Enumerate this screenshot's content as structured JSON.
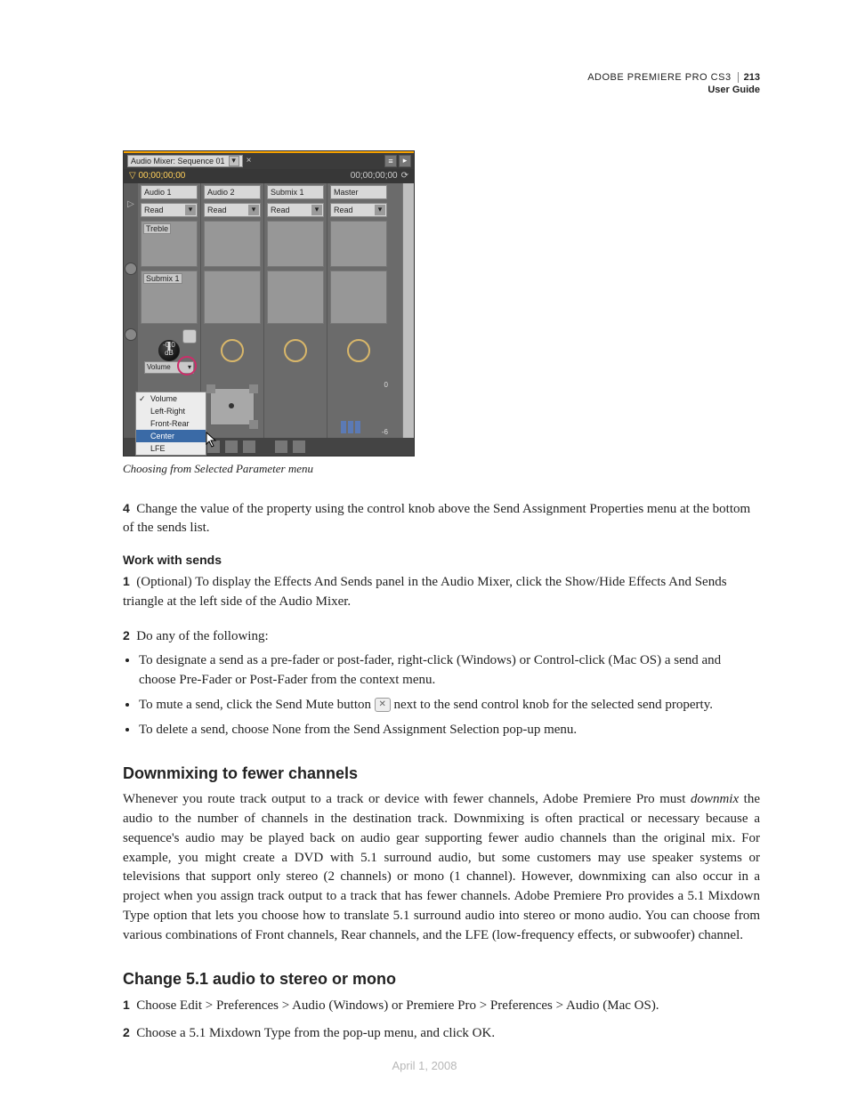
{
  "header": {
    "product": "ADOBE PREMIERE PRO CS3",
    "guide": "User Guide",
    "page_number": "213"
  },
  "figure": {
    "caption": "Choosing from Selected Parameter menu",
    "panel_title": "Audio Mixer: Sequence 01",
    "timecode_left": "00;00;00;00",
    "timecode_right": "00;00;00;00",
    "channels": [
      {
        "name": "Audio 1",
        "mode": "Read",
        "fx_label": "Treble",
        "send_label": "Submix 1"
      },
      {
        "name": "Audio 2",
        "mode": "Read"
      },
      {
        "name": "Submix 1",
        "mode": "Read"
      },
      {
        "name": "Master",
        "mode": "Read"
      }
    ],
    "knob_readout": {
      "db": "-0.0",
      "unit": "dB"
    },
    "volume_dd_label": "Volume",
    "context_menu": {
      "items": [
        "Volume",
        "Left-Right",
        "Front-Rear",
        "Center",
        "LFE"
      ],
      "checked": "Volume",
      "selected": "Center"
    },
    "master_badge": "0",
    "master_bottom": "-6"
  },
  "body": {
    "step4_num": "4",
    "step4": "Change the value of the property using the control knob above the Send Assignment Properties menu at the bottom of the sends list.",
    "sends_head": "Work with sends",
    "sends_step1_num": "1",
    "sends_step1": "(Optional) To display the Effects And Sends panel in the Audio Mixer, click the Show/Hide Effects And Sends triangle at the left side of the Audio Mixer.",
    "sends_step2_num": "2",
    "sends_step2": "Do any of the following:",
    "bullets": [
      "To designate a send as a pre-fader or post-fader, right-click (Windows) or Control-click (Mac OS) a send and choose Pre-Fader or Post-Fader from the context menu.",
      "To mute a send, click the Send Mute button",
      "next to the send control knob for the selected send property.",
      "To delete a send, choose None from the Send Assignment Selection pop-up menu."
    ],
    "downmix_head": "Downmixing to fewer channels",
    "downmix_para_a": "Whenever you route track output to a track or device with fewer channels, Adobe Premiere Pro must ",
    "downmix_em": "downmix",
    "downmix_para_b": " the audio to the number of channels in the destination track. Downmixing is often practical or necessary because a sequence's audio may be played back on audio gear supporting fewer audio channels than the original mix. For example, you might create a DVD with 5.1 surround audio, but some customers may use speaker systems or televisions that support only stereo (2 channels) or mono (1 channel). However, downmixing can also occur in a project when you assign track output to a track that has fewer channels. Adobe Premiere Pro provides a 5.1 Mixdown Type option that lets you choose how to translate 5.1 surround audio into stereo or mono audio. You can choose from various combinations of Front channels, Rear channels, and the LFE (low-frequency effects, or subwoofer) channel.",
    "change51_head": "Change 5.1 audio to stereo or mono",
    "change51_step1_num": "1",
    "change51_step1": "Choose Edit > Preferences > Audio (Windows) or Premiere Pro > Preferences > Audio (Mac OS).",
    "change51_step2_num": "2",
    "change51_step2": "Choose a 5.1 Mixdown Type from the pop-up menu, and click OK."
  },
  "footer_date": "April 1, 2008"
}
